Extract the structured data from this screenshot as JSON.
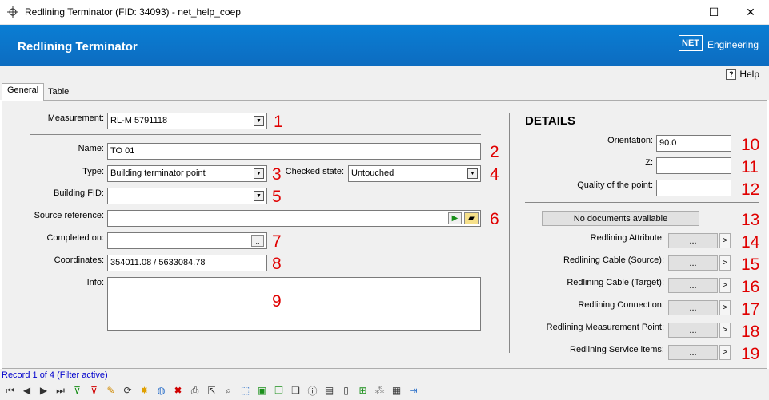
{
  "window": {
    "title": "Redlining Terminator (FID: 34093) - net_help_coep",
    "minimize": "—",
    "maximize": "☐",
    "close": "✕"
  },
  "banner": {
    "title": "Redlining Terminator",
    "logo_mark": "NET",
    "logo_text": "Engineering"
  },
  "help": {
    "icon": "?",
    "label": "Help"
  },
  "tabs": [
    {
      "label": "General"
    },
    {
      "label": "Table"
    }
  ],
  "form": {
    "measurement": {
      "label": "Measurement:",
      "value": "RL-M 5791118",
      "marker": "1"
    },
    "name": {
      "label": "Name:",
      "value": "TO 01",
      "marker": "2"
    },
    "type": {
      "label": "Type:",
      "value": "Building terminator point",
      "marker": "3"
    },
    "checked_state": {
      "label": "Checked state:",
      "value": "Untouched",
      "marker": "4"
    },
    "building_fid": {
      "label": "Building FID:",
      "value": "",
      "marker": "5"
    },
    "source_reference": {
      "label": "Source reference:",
      "value": "",
      "marker": "6"
    },
    "completed_on": {
      "label": "Completed on:",
      "value": "",
      "button": "..",
      "marker": "7"
    },
    "coordinates": {
      "label": "Coordinates:",
      "value": "354011.08 / 5633084.78",
      "marker": "8"
    },
    "info": {
      "label": "Info:",
      "value": "",
      "marker": "9"
    }
  },
  "details": {
    "title": "DETAILS",
    "orientation": {
      "label": "Orientation:",
      "value": "90.0",
      "marker": "10"
    },
    "z": {
      "label": "Z:",
      "value": "",
      "marker": "11"
    },
    "quality": {
      "label": "Quality of the point:",
      "value": "",
      "marker": "12"
    },
    "documents": {
      "label": "No documents available",
      "marker": "13"
    },
    "relations": [
      {
        "label": "Redlining Attribute:",
        "button": "...",
        "nav": ">",
        "marker": "14"
      },
      {
        "label": "Redlining Cable (Source):",
        "button": "...",
        "nav": ">",
        "marker": "15"
      },
      {
        "label": "Redlining Cable (Target):",
        "button": "...",
        "nav": ">",
        "marker": "16"
      },
      {
        "label": "Redlining Connection:",
        "button": "...",
        "nav": ">",
        "marker": "17"
      },
      {
        "label": "Redlining Measurement Point:",
        "button": "...",
        "nav": ">",
        "marker": "18"
      },
      {
        "label": "Redlining Service items:",
        "button": "...",
        "nav": ">",
        "marker": "19"
      }
    ]
  },
  "status": {
    "record": "Record 1 of 4 (Filter active)"
  },
  "toolbar": [
    {
      "icon": "first-record-icon",
      "glyph": "⏮",
      "color": "#333"
    },
    {
      "icon": "prev-record-icon",
      "glyph": "◀",
      "color": "#333"
    },
    {
      "icon": "next-record-icon",
      "glyph": "▶",
      "color": "#333"
    },
    {
      "icon": "last-record-icon",
      "glyph": "⏭",
      "color": "#333"
    },
    {
      "icon": "add-filter-icon",
      "glyph": "⊽",
      "color": "#1a8f1a"
    },
    {
      "icon": "remove-filter-icon",
      "glyph": "⊽",
      "color": "#d00000"
    },
    {
      "icon": "edit-icon",
      "glyph": "✎",
      "color": "#d08a00"
    },
    {
      "icon": "refresh-icon",
      "glyph": "⟳",
      "color": "#333"
    },
    {
      "icon": "new-icon",
      "glyph": "✸",
      "color": "#e0a000"
    },
    {
      "icon": "globe-icon",
      "glyph": "◍",
      "color": "#2a6fc9"
    },
    {
      "icon": "delete-icon",
      "glyph": "✖",
      "color": "#d00000"
    },
    {
      "icon": "print-icon",
      "glyph": "⎙",
      "color": "#333"
    },
    {
      "icon": "select-icon",
      "glyph": "⇱",
      "color": "#333"
    },
    {
      "icon": "zoom-icon",
      "glyph": "⌕",
      "color": "#333"
    },
    {
      "icon": "zoom-extent-icon",
      "glyph": "⬚",
      "color": "#2a6fc9"
    },
    {
      "icon": "layer-icon",
      "glyph": "▣",
      "color": "#1a8f1a"
    },
    {
      "icon": "copy-icon",
      "glyph": "❐",
      "color": "#1a8f1a"
    },
    {
      "icon": "duplicate-icon",
      "glyph": "❏",
      "color": "#333"
    },
    {
      "icon": "info-icon",
      "glyph": "ⓘ",
      "color": "#333"
    },
    {
      "icon": "report-icon",
      "glyph": "▤",
      "color": "#333"
    },
    {
      "icon": "document-icon",
      "glyph": "▯",
      "color": "#333"
    },
    {
      "icon": "export-icon",
      "glyph": "⊞",
      "color": "#1a8f1a"
    },
    {
      "icon": "settings-icon",
      "glyph": "⁂",
      "color": "#888"
    },
    {
      "icon": "table-icon",
      "glyph": "▦",
      "color": "#333"
    },
    {
      "icon": "exit-icon",
      "glyph": "⇥",
      "color": "#2a6fc9"
    }
  ]
}
